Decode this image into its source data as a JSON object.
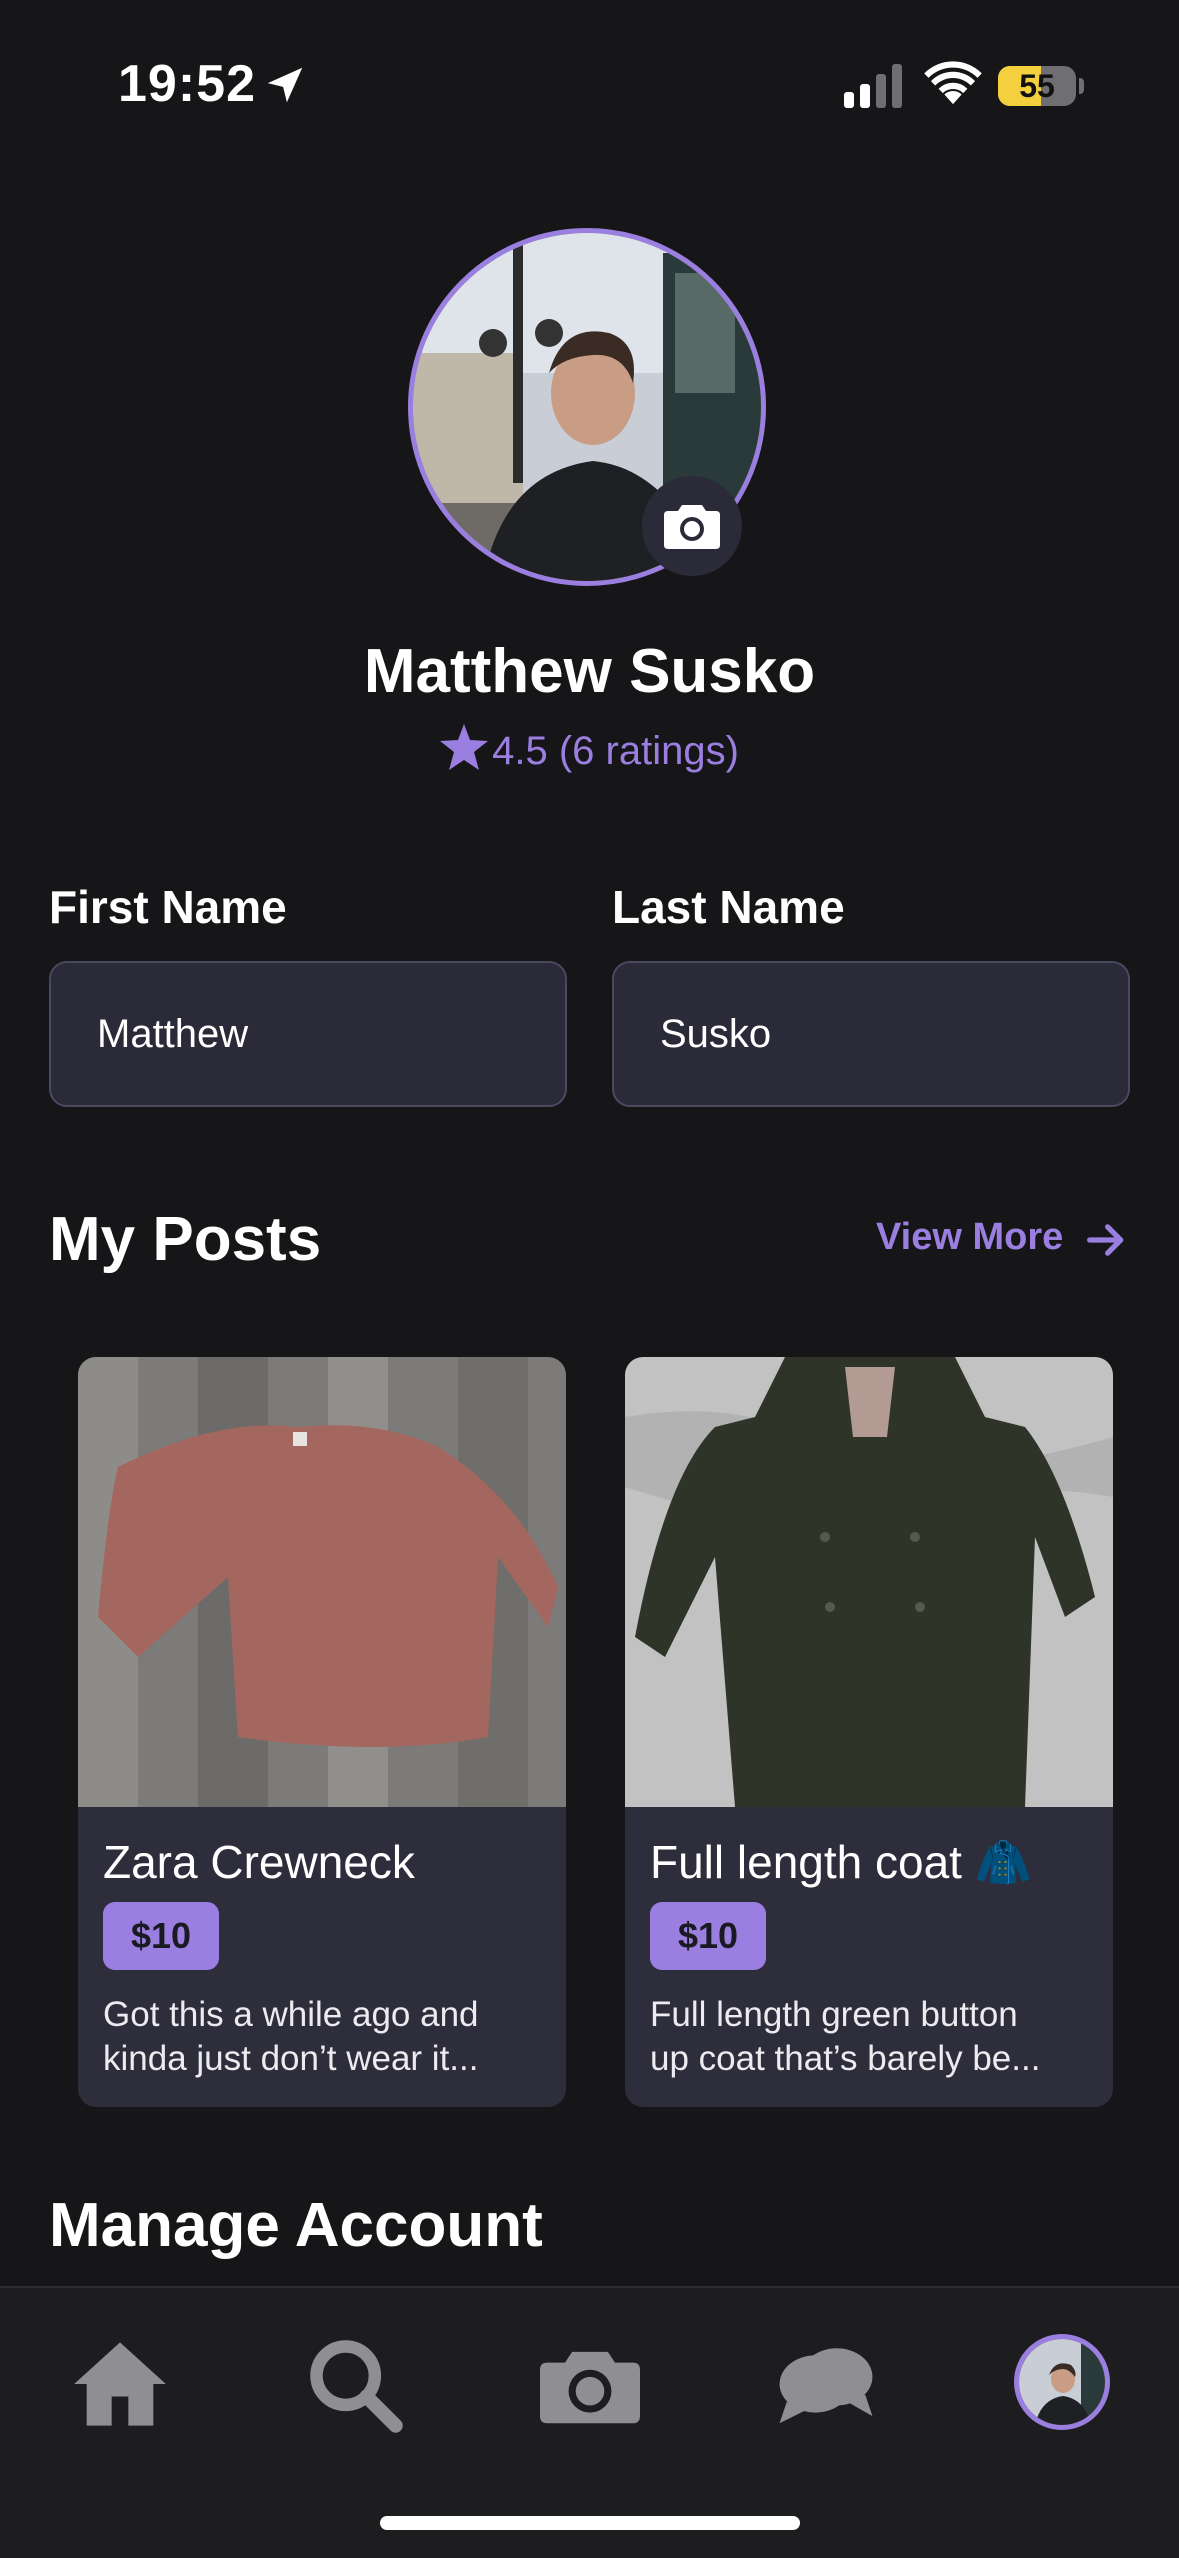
{
  "status_bar": {
    "time": "19:52",
    "battery_level": "55",
    "icons": [
      "location-arrow-icon",
      "cellular-signal-icon",
      "wifi-icon",
      "battery-icon"
    ]
  },
  "profile": {
    "name": "Matthew Susko",
    "rating_text": "4.5 (6 ratings)",
    "star_icon": "star-icon",
    "camera_icon": "camera-icon"
  },
  "form": {
    "first_name_label": "First Name",
    "first_name_value": "Matthew",
    "last_name_label": "Last Name",
    "last_name_value": "Susko"
  },
  "my_posts": {
    "title": "My Posts",
    "view_more": "View More",
    "posts": [
      {
        "title": "Zara Crewneck",
        "price": "$10",
        "desc_line1": "Got this a while ago and",
        "desc_line2": "kinda just don’t wear it..."
      },
      {
        "title": "Full length coat 🧥",
        "price": "$10",
        "desc_line1": "Full length green button",
        "desc_line2": "up coat that’s barely be..."
      }
    ]
  },
  "manage_account": {
    "title": "Manage Account"
  },
  "tab_bar": {
    "items": [
      "home-icon",
      "search-icon",
      "camera-icon",
      "chat-icon",
      "profile-avatar"
    ]
  },
  "colors": {
    "accent": "#9b7fe0",
    "background": "#161618",
    "card": "#2e2d3c",
    "input": "#2b2a38",
    "battery": "#f4d03f"
  }
}
